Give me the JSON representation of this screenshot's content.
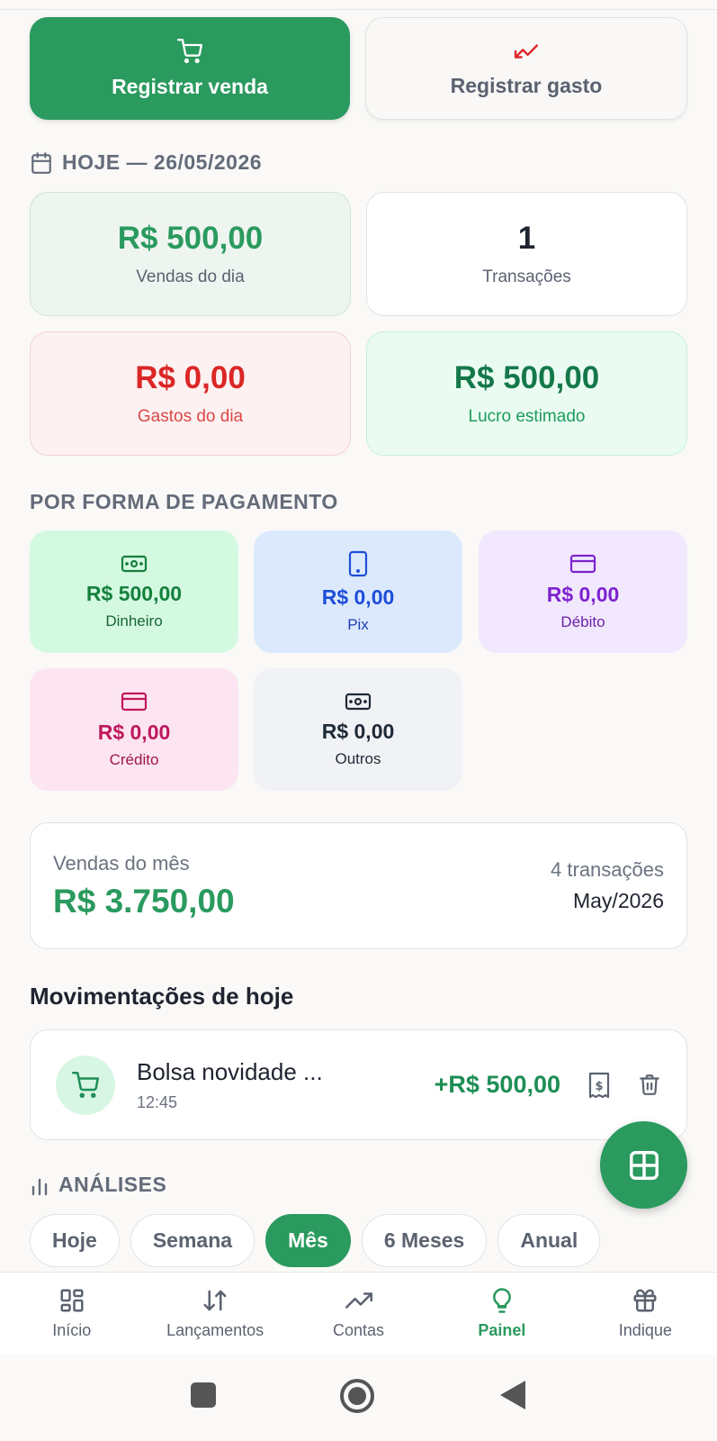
{
  "actions": {
    "sale_label": "Registrar venda",
    "expense_label": "Registrar gasto"
  },
  "today": {
    "title": "HOJE — 26/05/2026",
    "sales_value": "R$ 500,00",
    "sales_label": "Vendas do dia",
    "transactions_value": "1",
    "transactions_label": "Transações",
    "expenses_value": "R$ 0,00",
    "expenses_label": "Gastos do dia",
    "profit_value": "R$ 500,00",
    "profit_label": "Lucro estimado"
  },
  "payment": {
    "title": "POR FORMA DE PAGAMENTO",
    "methods": [
      {
        "value": "R$ 500,00",
        "label": "Dinheiro",
        "icon": "cash-icon",
        "color": "#15803d"
      },
      {
        "value": "R$ 0,00",
        "label": "Pix",
        "icon": "phone-icon",
        "color": "#1d4ed8"
      },
      {
        "value": "R$ 0,00",
        "label": "Débito",
        "icon": "card-icon",
        "color": "#7e22ce"
      },
      {
        "value": "R$ 0,00",
        "label": "Crédito",
        "icon": "card-icon",
        "color": "#be185d"
      },
      {
        "value": "R$ 0,00",
        "label": "Outros",
        "icon": "cash-icon",
        "color": "#1f2937"
      }
    ]
  },
  "month": {
    "label": "Vendas do mês",
    "value": "R$ 3.750,00",
    "count": "4 transações",
    "period": "May/2026"
  },
  "movements": {
    "title": "Movimentações de hoje",
    "items": [
      {
        "name": "Bolsa novidade ...",
        "time": "12:45",
        "amount": "+R$ 500,00"
      }
    ]
  },
  "analytics": {
    "title": "ANÁLISES",
    "chips": [
      "Hoje",
      "Semana",
      "Mês",
      "6 Meses",
      "Anual"
    ],
    "active": "Mês"
  },
  "nav": {
    "items": [
      "Início",
      "Lançamentos",
      "Contas",
      "Painel",
      "Indique"
    ],
    "active": "Painel"
  },
  "colors": {
    "brand_green": "#2a9a5e",
    "expense_red": "#dc2626"
  }
}
